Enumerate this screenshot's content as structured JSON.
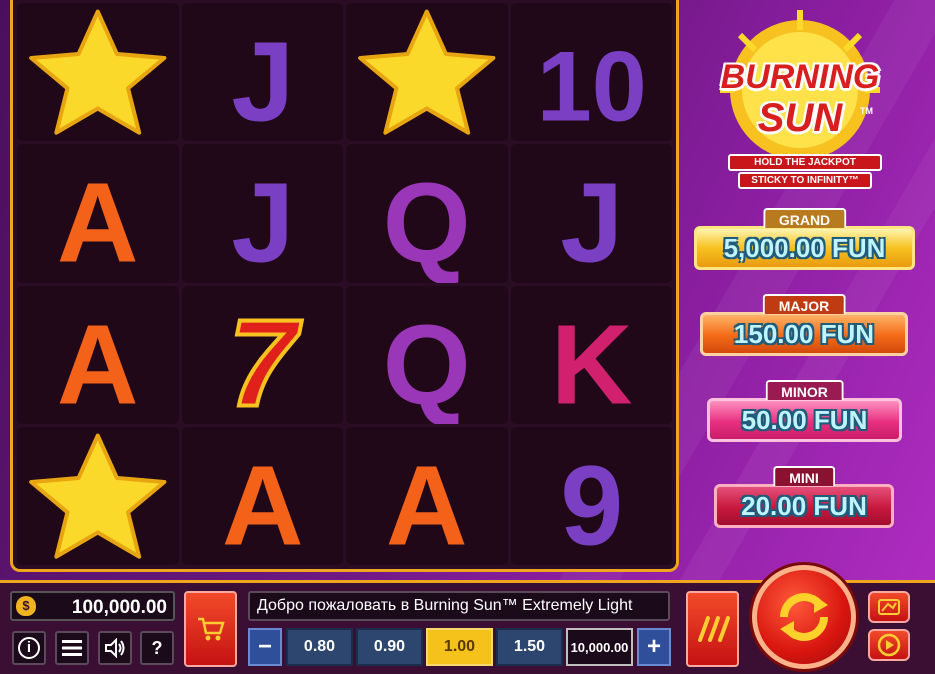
{
  "game": {
    "logo": {
      "line1": "BURNING",
      "line2": "SUN",
      "trademark": "TM",
      "banner1": "HOLD THE JACKPOT",
      "banner2": "STICKY TO INFINITY™"
    },
    "reels": [
      [
        "star",
        "A",
        "A",
        "star"
      ],
      [
        "J",
        "J",
        "7",
        "A"
      ],
      [
        "star",
        "Q",
        "Q",
        "A"
      ],
      [
        "10",
        "J",
        "K",
        "9"
      ]
    ],
    "symbol_colors": {
      "A": "#f4621a",
      "J": "#7b3fc4",
      "Q": "#9a37b8",
      "K": "#d0206e",
      "10": "#7b3fc4",
      "9": "#7b3fc4",
      "7": "#e0201a",
      "star": "#fbd92a"
    }
  },
  "jackpots": {
    "grand": {
      "label": "GRAND",
      "value": "5,000.00 FUN"
    },
    "major": {
      "label": "MAJOR",
      "value": "150.00 FUN"
    },
    "minor": {
      "label": "MINOR",
      "value": "50.00 FUN"
    },
    "mini": {
      "label": "MINI",
      "value": "20.00 FUN"
    }
  },
  "bottom_bar": {
    "balance": "100,000.00",
    "balance_icon": "$",
    "info_label": "i",
    "menu_icon": "menu-icon",
    "sound_icon": "speaker-icon",
    "help_label": "?",
    "message": "Добро пожаловать в Burning Sun™ Extremely Light",
    "bet": {
      "decrease": "−",
      "increase": "+",
      "options": [
        "0.80",
        "0.90",
        "1.00",
        "1.50"
      ],
      "selected": "1.00",
      "total": "10,000.00"
    }
  }
}
